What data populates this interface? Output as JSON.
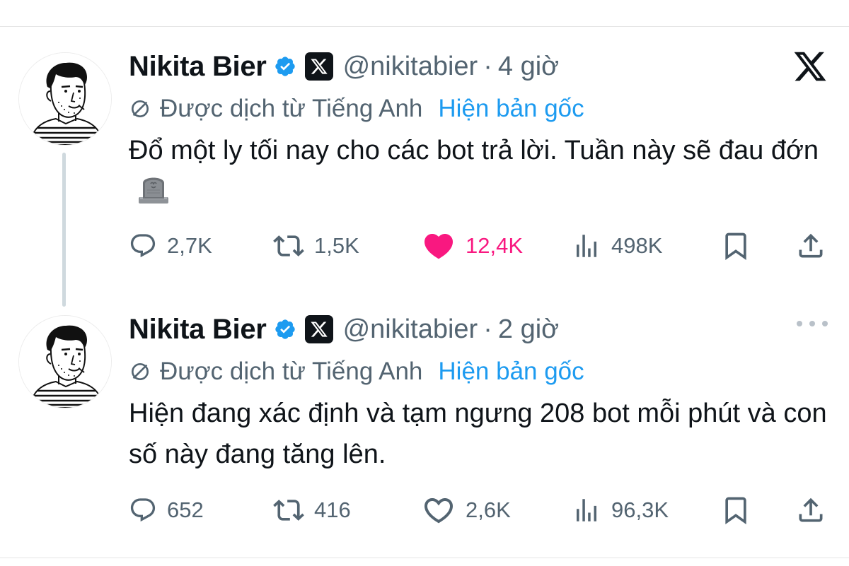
{
  "tweets": [
    {
      "author": "Nikita Bier",
      "handle": "@nikitabier",
      "separator": "·",
      "time": "4 giờ",
      "translated_label": "Được dịch từ Tiếng Anh",
      "show_original": "Hiện bản gốc",
      "text": "Đổ một ly tối nay cho các bot trả lời. Tuần này sẽ đau đớn",
      "emoji": "headstone-icon",
      "replies": "2,7K",
      "reposts": "1,5K",
      "likes": "12,4K",
      "liked": true,
      "views": "498K",
      "corner": "x-logo-icon"
    },
    {
      "author": "Nikita Bier",
      "handle": "@nikitabier",
      "separator": "·",
      "time": "2 giờ",
      "translated_label": "Được dịch từ Tiếng Anh",
      "show_original": "Hiện bản gốc",
      "text": "Hiện đang xác định và tạm ngưng 208 bot mỗi phút và con số này đang tăng lên.",
      "replies": "652",
      "reposts": "416",
      "likes": "2,6K",
      "liked": false,
      "views": "96,3K",
      "corner": "more-icon"
    }
  ],
  "colors": {
    "text": "#0f1419",
    "secondary": "#536471",
    "link": "#1d9bf0",
    "verified": "#1d9bf0",
    "like_active": "#f91880",
    "thread_line": "#cfd9de"
  }
}
